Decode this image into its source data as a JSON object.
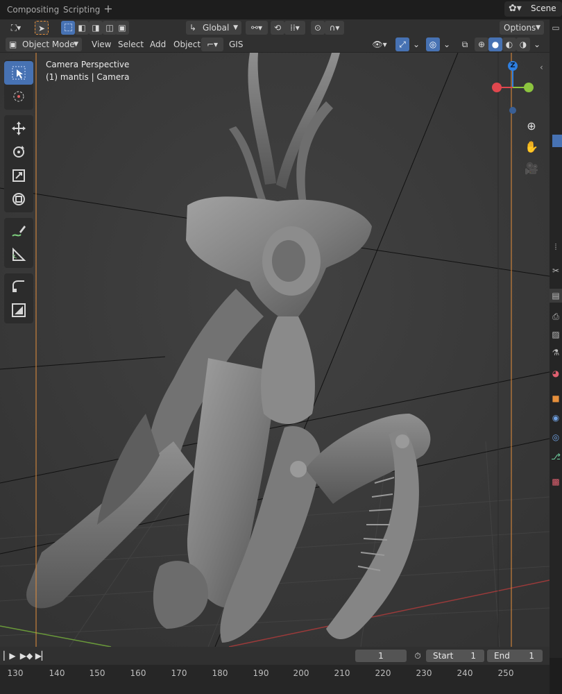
{
  "workspace_tabs": [
    "Compositing",
    "Scripting"
  ],
  "add_tab_label": "+",
  "scene": {
    "label": "Scene",
    "icon": "scene-icon"
  },
  "tool_header": {
    "transform_orientation": "Global",
    "options_label": "Options"
  },
  "view_header": {
    "mode": "Object Mode",
    "menus": [
      "View",
      "Select",
      "Add",
      "Object",
      "GIS"
    ]
  },
  "overlay": {
    "title": "Camera Perspective",
    "subtitle": "(1) mantis | Camera"
  },
  "gizmo": {
    "z_label": "Z"
  },
  "tools": [
    [
      "select-box-icon",
      "cursor-icon"
    ],
    [
      "move-icon",
      "rotate-icon",
      "scale-icon",
      "transform-icon"
    ],
    [
      "annotate-icon",
      "measure-icon"
    ],
    [
      "add-cube-icon",
      "camera-frame-icon"
    ]
  ],
  "timeline": {
    "current_frame": "1",
    "start_label": "Start",
    "start_value": "1",
    "end_label": "End",
    "end_value": "1",
    "ruler": [
      "130",
      "140",
      "150",
      "160",
      "170",
      "180",
      "190",
      "200",
      "210",
      "220",
      "230",
      "240",
      "250"
    ]
  },
  "colors": {
    "accent": "#4772b3",
    "axis_x": "#e0474e",
    "axis_y": "#8cc43f",
    "axis_z": "#2e7fe0",
    "camera_frame": "#e6903c"
  }
}
